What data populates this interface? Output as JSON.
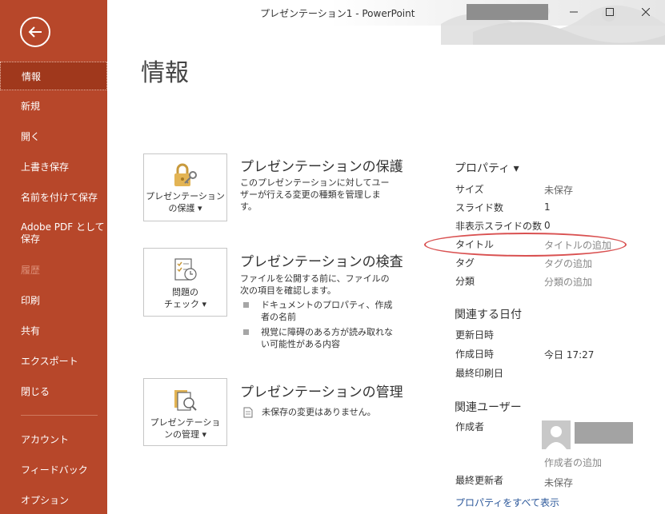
{
  "window": {
    "title": "プレゼンテーション1  -  PowerPoint",
    "buttons": [
      "minimize",
      "maximize",
      "close"
    ]
  },
  "sidebar": {
    "items": [
      {
        "label": "情報",
        "state": "active"
      },
      {
        "label": "新規"
      },
      {
        "label": "開く"
      },
      {
        "label": "上書き保存"
      },
      {
        "label": "名前を付けて保存"
      },
      {
        "label": "Adobe PDF として保存"
      },
      {
        "label": "履歴",
        "state": "disabled"
      },
      {
        "label": "印刷"
      },
      {
        "label": "共有"
      },
      {
        "label": "エクスポート"
      },
      {
        "label": "閉じる"
      },
      {
        "label": "アカウント"
      },
      {
        "label": "フィードバック"
      },
      {
        "label": "オプション"
      }
    ],
    "accent": "#b7472a"
  },
  "main": {
    "title": "情報",
    "protect": {
      "button_line1": "プレゼンテーション",
      "button_line2": "の保護 ▾",
      "title": "プレゼンテーションの保護",
      "desc": "このプレゼンテーションに対してユーザーが行える変更の種類を管理します。"
    },
    "inspect": {
      "button_line1": "問題の",
      "button_line2": "チェック ▾",
      "title": "プレゼンテーションの検査",
      "desc": "ファイルを公開する前に、ファイルの次の項目を確認します。",
      "bullets": [
        "ドキュメントのプロパティ、作成者の名前",
        "視覚に障碍のある方が読み取れない可能性がある内容"
      ]
    },
    "manage": {
      "button_line1": "プレゼンテーショ",
      "button_line2": "ンの管理 ▾",
      "title": "プレゼンテーションの管理",
      "status": "未保存の変更はありません。"
    }
  },
  "properties": {
    "header": "プロパティ ▾",
    "rows": [
      {
        "label": "サイズ",
        "value": "未保存"
      },
      {
        "label": "スライド数",
        "value": "1"
      },
      {
        "label": "非表示スライドの数",
        "value": "0"
      },
      {
        "label": "タイトル",
        "value": "タイトルの追加"
      },
      {
        "label": "タグ",
        "value": "タグの追加"
      },
      {
        "label": "分類",
        "value": "分類の追加"
      }
    ],
    "dates_header": "関連する日付",
    "dates": [
      {
        "label": "更新日時",
        "value": ""
      },
      {
        "label": "作成日時",
        "value": "今日 17:27"
      },
      {
        "label": "最終印刷日",
        "value": ""
      }
    ],
    "people_header": "関連ユーザー",
    "author_label": "作成者",
    "add_author": "作成者の追加",
    "last_modified_by_label": "最終更新者",
    "last_modified_by_value": "未保存",
    "show_all": "プロパティをすべて表示"
  }
}
